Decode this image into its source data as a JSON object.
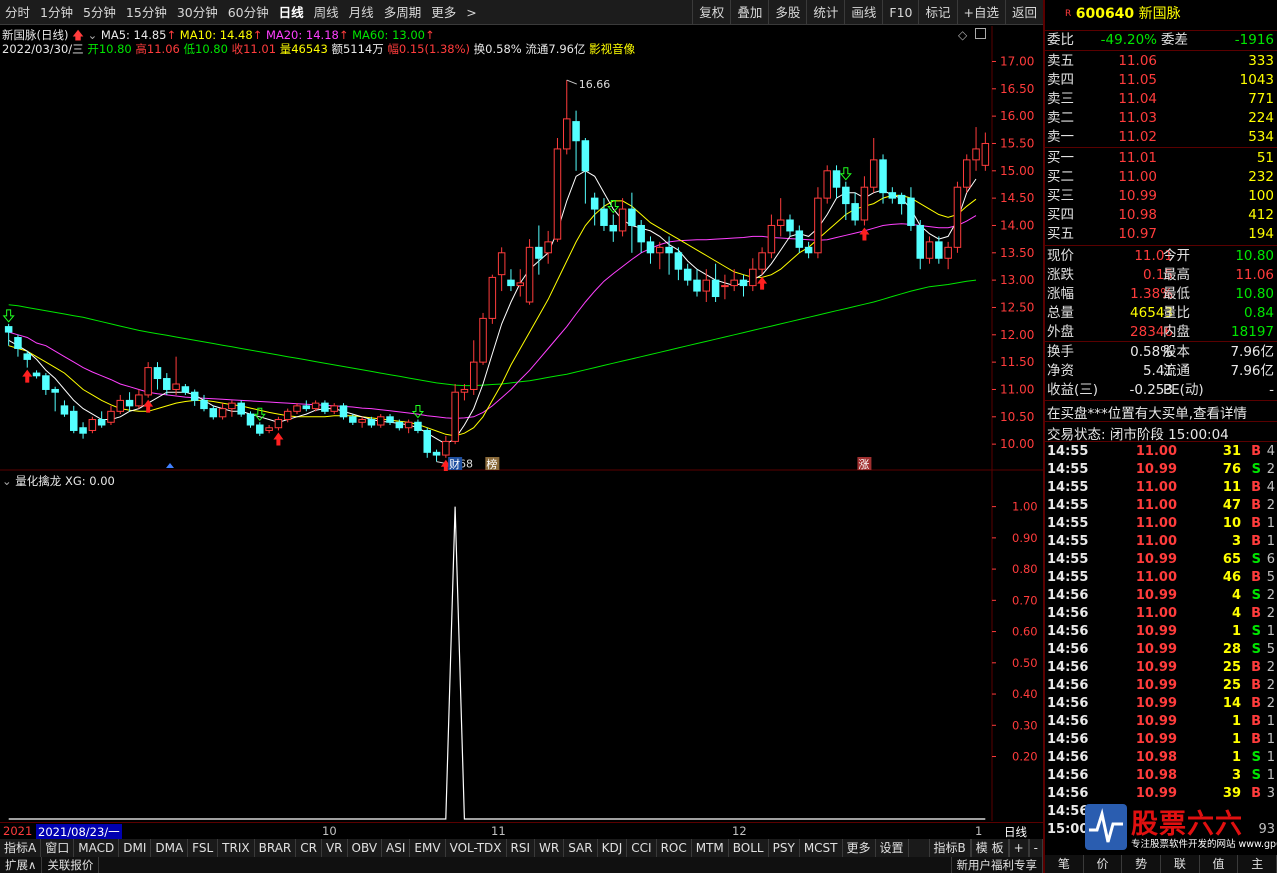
{
  "toolbar": {
    "timeframes": [
      "分时",
      "1分钟",
      "5分钟",
      "15分钟",
      "30分钟",
      "60分钟",
      "日线",
      "周线",
      "月线",
      "多周期",
      "更多"
    ],
    "active_timeframe": "日线",
    "more_arrow": ">",
    "right_buttons": [
      "复权",
      "叠加",
      "多股",
      "统计",
      "画线",
      "F10",
      "标记",
      "+自选",
      "返回"
    ]
  },
  "chart_header": {
    "name": "新国脉(日线)",
    "ma5": "MA5: 14.85",
    "ma10": "MA10: 14.48",
    "ma20": "MA20: 14.18",
    "ma60": "MA60: 13.00",
    "date": "2022/03/30/三",
    "open": "开10.80",
    "high": "高11.06",
    "low": "低10.80",
    "close": "收11.01",
    "volume": "量46543",
    "amount": "额5114万",
    "range": "幅0.15(1.38%)",
    "turnover": "换0.58%",
    "float": "流通7.96亿",
    "concept": "影视音像",
    "high_label": "16.66",
    "low_label": "9.68",
    "marker_cai": "财",
    "marker_bang": "榜",
    "marker_zhang": "涨"
  },
  "indicator_header": {
    "name": "量化擒龙",
    "value": "XG: 0.00"
  },
  "price_axis": [
    "17.00",
    "16.50",
    "16.00",
    "15.50",
    "15.00",
    "14.50",
    "14.00",
    "13.50",
    "13.00",
    "12.50",
    "12.00",
    "11.50",
    "11.00",
    "10.50",
    "10.00"
  ],
  "ind_axis": [
    "1.00",
    "0.90",
    "0.80",
    "0.70",
    "0.60",
    "0.50",
    "0.40",
    "0.30",
    "0.20"
  ],
  "datebar": {
    "start": "2021",
    "cursor": "2021/08/23/一",
    "m10": "10",
    "m11": "11",
    "m12": "12",
    "m1": "1",
    "period": "日线"
  },
  "indicator_tabs": [
    "指标A",
    "窗口",
    "MACD",
    "DMI",
    "DMA",
    "FSL",
    "TRIX",
    "BRAR",
    "CR",
    "VR",
    "OBV",
    "ASI",
    "EMV",
    "VOL-TDX",
    "RSI",
    "WR",
    "SAR",
    "KDJ",
    "CCI",
    "ROC",
    "MTM",
    "BOLL",
    "PSY",
    "MCST",
    "更多",
    "设置"
  ],
  "indicator_tabs_right": [
    "指标B",
    "模 板",
    "+",
    "-"
  ],
  "statusbar": [
    "扩展∧",
    "关联报价"
  ],
  "statusbar_right": "新用户福利专享",
  "stock": {
    "badge": "R",
    "code": "600640",
    "name": "新国脉"
  },
  "order_ratio": {
    "l1": "委比",
    "v1": "-49.20%",
    "l2": "委差",
    "v2": "-1916"
  },
  "asks": [
    {
      "label": "卖五",
      "price": "11.06",
      "vol": "333"
    },
    {
      "label": "卖四",
      "price": "11.05",
      "vol": "1043"
    },
    {
      "label": "卖三",
      "price": "11.04",
      "vol": "771"
    },
    {
      "label": "卖二",
      "price": "11.03",
      "vol": "224"
    },
    {
      "label": "卖一",
      "price": "11.02",
      "vol": "534"
    }
  ],
  "bids": [
    {
      "label": "买一",
      "price": "11.01",
      "vol": "51"
    },
    {
      "label": "买二",
      "price": "11.00",
      "vol": "232"
    },
    {
      "label": "买三",
      "price": "10.99",
      "vol": "100"
    },
    {
      "label": "买四",
      "price": "10.98",
      "vol": "412"
    },
    {
      "label": "买五",
      "price": "10.97",
      "vol": "194"
    }
  ],
  "quote": [
    {
      "l1": "现价",
      "v1": "11.01",
      "c1": "red",
      "l2": "今开",
      "v2": "10.80",
      "c2": "green"
    },
    {
      "l1": "涨跌",
      "v1": "0.15",
      "c1": "red",
      "l2": "最高",
      "v2": "11.06",
      "c2": "red"
    },
    {
      "l1": "涨幅",
      "v1": "1.38%",
      "c1": "red",
      "l2": "最低",
      "v2": "10.80",
      "c2": "green"
    },
    {
      "l1": "总量",
      "v1": "46543",
      "c1": "yellow",
      "l2": "量比",
      "v2": "0.84",
      "c2": "green"
    },
    {
      "l1": "外盘",
      "v1": "28346",
      "c1": "red",
      "l2": "内盘",
      "v2": "18197",
      "c2": "green"
    }
  ],
  "quote2": [
    {
      "l1": "换手",
      "v1": "0.58%",
      "l2": "股本",
      "v2": "7.96亿"
    },
    {
      "l1": "净资",
      "v1": "5.41",
      "l2": "流通",
      "v2": "7.96亿"
    },
    {
      "l1": "收益(三)",
      "v1": "-0.253",
      "l2": "PE(动)",
      "v2": "-"
    }
  ],
  "notice": "在买盘***位置有大买单,查看详情",
  "trade_status": "交易状态: 闭市阶段 15:00:04",
  "ticks": [
    {
      "t": "14:55",
      "p": "11.00",
      "v": "31",
      "d": "B",
      "n": "4"
    },
    {
      "t": "14:55",
      "p": "10.99",
      "v": "76",
      "d": "S",
      "n": "2"
    },
    {
      "t": "14:55",
      "p": "11.00",
      "v": "11",
      "d": "B",
      "n": "4"
    },
    {
      "t": "14:55",
      "p": "11.00",
      "v": "47",
      "d": "B",
      "n": "2"
    },
    {
      "t": "14:55",
      "p": "11.00",
      "v": "10",
      "d": "B",
      "n": "1"
    },
    {
      "t": "14:55",
      "p": "11.00",
      "v": "3",
      "d": "B",
      "n": "1"
    },
    {
      "t": "14:55",
      "p": "10.99",
      "v": "65",
      "d": "S",
      "n": "6"
    },
    {
      "t": "14:55",
      "p": "11.00",
      "v": "46",
      "d": "B",
      "n": "5"
    },
    {
      "t": "14:56",
      "p": "10.99",
      "v": "4",
      "d": "S",
      "n": "2"
    },
    {
      "t": "14:56",
      "p": "11.00",
      "v": "4",
      "d": "B",
      "n": "2"
    },
    {
      "t": "14:56",
      "p": "10.99",
      "v": "1",
      "d": "S",
      "n": "1"
    },
    {
      "t": "14:56",
      "p": "10.99",
      "v": "28",
      "d": "S",
      "n": "5"
    },
    {
      "t": "14:56",
      "p": "10.99",
      "v": "25",
      "d": "B",
      "n": "2"
    },
    {
      "t": "14:56",
      "p": "10.99",
      "v": "25",
      "d": "B",
      "n": "2"
    },
    {
      "t": "14:56",
      "p": "10.99",
      "v": "14",
      "d": "B",
      "n": "2"
    },
    {
      "t": "14:56",
      "p": "10.99",
      "v": "1",
      "d": "B",
      "n": "1"
    },
    {
      "t": "14:56",
      "p": "10.99",
      "v": "1",
      "d": "B",
      "n": "1"
    },
    {
      "t": "14:56",
      "p": "10.98",
      "v": "1",
      "d": "S",
      "n": "1"
    },
    {
      "t": "14:56",
      "p": "10.98",
      "v": "3",
      "d": "S",
      "n": "1"
    },
    {
      "t": "14:56",
      "p": "10.99",
      "v": "39",
      "d": "B",
      "n": "3"
    },
    {
      "t": "14:56",
      "p": "",
      "v": "",
      "d": "",
      "n": ""
    },
    {
      "t": "15:00",
      "p": "",
      "v": "",
      "d": "",
      "n": "93"
    }
  ],
  "right_tabs": [
    "笔",
    "价",
    "势",
    "联",
    "值",
    "主"
  ],
  "watermark": {
    "title": "股票六六",
    "url": "专注股票软件开发的网站 www.gp66.cn"
  },
  "chart_data": {
    "type": "candlestick",
    "price_range": [
      9.6,
      17.1
    ],
    "candles": [
      [
        12.15,
        12.05,
        11.8,
        12.2
      ],
      [
        11.95,
        11.75,
        11.6,
        12.0
      ],
      [
        11.65,
        11.55,
        11.4,
        11.7
      ],
      [
        11.3,
        11.25,
        11.2,
        11.35
      ],
      [
        11.25,
        11.0,
        10.9,
        11.3
      ],
      [
        11.0,
        10.95,
        10.6,
        11.05
      ],
      [
        10.7,
        10.55,
        10.5,
        10.8
      ],
      [
        10.6,
        10.25,
        10.2,
        10.7
      ],
      [
        10.3,
        10.2,
        10.1,
        10.4
      ],
      [
        10.25,
        10.45,
        10.2,
        10.5
      ],
      [
        10.45,
        10.35,
        10.3,
        10.6
      ],
      [
        10.4,
        10.6,
        10.35,
        10.7
      ],
      [
        10.6,
        10.8,
        10.55,
        10.9
      ],
      [
        10.8,
        10.7,
        10.6,
        10.95
      ],
      [
        10.7,
        10.9,
        10.65,
        11.0
      ],
      [
        10.9,
        11.4,
        10.85,
        11.5
      ],
      [
        11.4,
        11.2,
        11.0,
        11.5
      ],
      [
        11.2,
        11.0,
        10.9,
        11.3
      ],
      [
        11.0,
        11.1,
        10.9,
        11.6
      ],
      [
        11.05,
        10.95,
        10.9,
        11.1
      ],
      [
        10.95,
        10.8,
        10.7,
        11.0
      ],
      [
        10.8,
        10.65,
        10.6,
        10.9
      ],
      [
        10.65,
        10.5,
        10.45,
        10.7
      ],
      [
        10.5,
        10.65,
        10.45,
        10.75
      ],
      [
        10.65,
        10.75,
        10.5,
        10.8
      ],
      [
        10.75,
        10.55,
        10.5,
        10.8
      ],
      [
        10.55,
        10.35,
        10.3,
        10.6
      ],
      [
        10.35,
        10.2,
        10.15,
        10.4
      ],
      [
        10.25,
        10.3,
        10.2,
        10.35
      ],
      [
        10.3,
        10.45,
        10.25,
        10.5
      ],
      [
        10.45,
        10.6,
        10.4,
        10.65
      ],
      [
        10.6,
        10.7,
        10.55,
        10.75
      ],
      [
        10.7,
        10.65,
        10.6,
        10.8
      ],
      [
        10.65,
        10.75,
        10.6,
        10.8
      ],
      [
        10.75,
        10.6,
        10.55,
        10.8
      ],
      [
        10.6,
        10.7,
        10.55,
        10.75
      ],
      [
        10.7,
        10.5,
        10.45,
        10.75
      ],
      [
        10.5,
        10.4,
        10.35,
        10.55
      ],
      [
        10.4,
        10.45,
        10.3,
        10.5
      ],
      [
        10.45,
        10.35,
        10.3,
        10.5
      ],
      [
        10.35,
        10.5,
        10.3,
        10.55
      ],
      [
        10.5,
        10.4,
        10.35,
        10.55
      ],
      [
        10.4,
        10.3,
        10.25,
        10.45
      ],
      [
        10.3,
        10.4,
        10.2,
        10.45
      ],
      [
        10.4,
        10.25,
        10.2,
        10.45
      ],
      [
        10.25,
        9.85,
        9.75,
        10.3
      ],
      [
        9.85,
        9.8,
        9.68,
        9.9
      ],
      [
        9.8,
        10.05,
        9.75,
        10.15
      ],
      [
        10.05,
        10.95,
        10.0,
        11.1
      ],
      [
        10.95,
        11.0,
        10.8,
        11.1
      ],
      [
        11.0,
        11.5,
        10.9,
        11.9
      ],
      [
        11.5,
        12.3,
        11.45,
        12.4
      ],
      [
        12.3,
        13.05,
        12.2,
        13.1
      ],
      [
        13.1,
        13.5,
        12.8,
        13.6
      ],
      [
        13.0,
        12.9,
        12.8,
        13.2
      ],
      [
        12.9,
        12.95,
        12.7,
        13.2
      ],
      [
        12.6,
        13.6,
        12.55,
        13.75
      ],
      [
        13.6,
        13.4,
        13.1,
        14.0
      ],
      [
        13.5,
        13.7,
        13.3,
        13.9
      ],
      [
        13.75,
        15.4,
        13.7,
        15.6
      ],
      [
        15.4,
        15.95,
        15.3,
        16.66
      ],
      [
        15.9,
        15.55,
        15.0,
        16.1
      ],
      [
        15.55,
        15.0,
        14.4,
        15.6
      ],
      [
        14.5,
        14.3,
        14.0,
        14.6
      ],
      [
        14.3,
        14.0,
        13.9,
        14.5
      ],
      [
        14.0,
        13.9,
        13.7,
        14.2
      ],
      [
        13.9,
        14.3,
        13.8,
        14.5
      ],
      [
        14.3,
        14.0,
        13.5,
        14.6
      ],
      [
        14.0,
        13.7,
        13.5,
        14.1
      ],
      [
        13.7,
        13.5,
        13.3,
        13.8
      ],
      [
        13.5,
        13.6,
        13.2,
        13.7
      ],
      [
        13.6,
        13.5,
        13.1,
        13.8
      ],
      [
        13.5,
        13.2,
        13.0,
        13.6
      ],
      [
        13.2,
        13.0,
        12.9,
        13.3
      ],
      [
        13.0,
        12.8,
        12.7,
        13.2
      ],
      [
        12.8,
        13.0,
        12.6,
        13.2
      ],
      [
        13.0,
        12.7,
        12.6,
        13.3
      ],
      [
        12.9,
        12.9,
        12.65,
        13.1
      ],
      [
        12.9,
        13.0,
        12.8,
        13.2
      ],
      [
        13.0,
        12.9,
        12.7,
        13.1
      ],
      [
        12.9,
        13.2,
        12.8,
        13.4
      ],
      [
        13.2,
        13.5,
        13.1,
        13.6
      ],
      [
        13.5,
        14.0,
        13.4,
        14.2
      ],
      [
        14.0,
        14.1,
        13.8,
        14.5
      ],
      [
        14.1,
        13.9,
        13.8,
        14.2
      ],
      [
        13.9,
        13.6,
        13.5,
        14.0
      ],
      [
        13.6,
        13.5,
        13.4,
        13.7
      ],
      [
        13.5,
        14.5,
        13.4,
        14.7
      ],
      [
        14.5,
        15.0,
        14.4,
        15.1
      ],
      [
        15.0,
        14.7,
        14.5,
        15.1
      ],
      [
        14.7,
        14.4,
        14.1,
        14.8
      ],
      [
        14.4,
        14.1,
        14.0,
        14.6
      ],
      [
        14.1,
        14.7,
        14.0,
        14.9
      ],
      [
        14.7,
        15.2,
        14.6,
        15.6
      ],
      [
        15.2,
        14.6,
        14.4,
        15.3
      ],
      [
        14.6,
        14.5,
        14.4,
        14.7
      ],
      [
        14.55,
        14.4,
        14.2,
        14.6
      ],
      [
        14.5,
        14.0,
        13.9,
        14.7
      ],
      [
        14.0,
        13.4,
        13.2,
        14.1
      ],
      [
        13.4,
        13.7,
        13.3,
        13.8
      ],
      [
        13.7,
        13.4,
        13.3,
        13.8
      ],
      [
        13.4,
        13.6,
        13.2,
        13.7
      ],
      [
        13.6,
        14.7,
        13.5,
        14.8
      ],
      [
        14.7,
        15.2,
        14.6,
        15.3
      ],
      [
        15.2,
        15.4,
        15.0,
        15.8
      ],
      [
        15.1,
        15.5,
        15.0,
        15.7
      ]
    ],
    "ma5": [
      11.9,
      11.8,
      11.7,
      11.55,
      11.35,
      11.2,
      11.0,
      10.8,
      10.65,
      10.55,
      10.45,
      10.45,
      10.5,
      10.6,
      10.65,
      10.75,
      10.85,
      10.95,
      10.95,
      10.95,
      10.9,
      10.8,
      10.7,
      10.65,
      10.6,
      10.6,
      10.55,
      10.5,
      10.45,
      10.4,
      10.45,
      10.5,
      10.55,
      10.62,
      10.65,
      10.65,
      10.6,
      10.55,
      10.5,
      10.45,
      10.42,
      10.4,
      10.38,
      10.35,
      10.3,
      10.2,
      10.1,
      10.0,
      10.1,
      10.35,
      10.65,
      11.1,
      11.65,
      12.2,
      12.6,
      12.95,
      13.2,
      13.35,
      13.5,
      13.9,
      14.45,
      14.9,
      15.0,
      14.9,
      14.6,
      14.3,
      14.1,
      14.0,
      13.95,
      13.9,
      13.8,
      13.65,
      13.55,
      13.35,
      13.2,
      13.1,
      13.0,
      12.95,
      12.9,
      12.95,
      13.0,
      13.1,
      13.3,
      13.55,
      13.8,
      13.85,
      13.8,
      13.95,
      14.2,
      14.5,
      14.6,
      14.6,
      14.5,
      14.6,
      14.65,
      14.55,
      14.5,
      14.3,
      14.0,
      13.85,
      13.75,
      13.8,
      14.1,
      14.6,
      14.85
    ],
    "ma10": [
      11.8,
      11.75,
      11.7,
      11.6,
      11.5,
      11.4,
      11.3,
      11.15,
      11.0,
      10.9,
      10.8,
      10.72,
      10.65,
      10.62,
      10.6,
      10.6,
      10.65,
      10.7,
      10.75,
      10.78,
      10.8,
      10.8,
      10.78,
      10.75,
      10.72,
      10.7,
      10.66,
      10.62,
      10.58,
      10.55,
      10.52,
      10.5,
      10.5,
      10.5,
      10.5,
      10.52,
      10.52,
      10.52,
      10.5,
      10.48,
      10.46,
      10.44,
      10.42,
      10.4,
      10.36,
      10.3,
      10.24,
      10.18,
      10.15,
      10.2,
      10.3,
      10.5,
      10.8,
      11.1,
      11.45,
      11.75,
      12.05,
      12.35,
      12.65,
      13.0,
      13.35,
      13.7,
      14.0,
      14.2,
      14.35,
      14.45,
      14.45,
      14.35,
      14.2,
      14.05,
      13.95,
      13.85,
      13.75,
      13.65,
      13.55,
      13.45,
      13.35,
      13.25,
      13.15,
      13.1,
      13.05,
      13.05,
      13.1,
      13.2,
      13.35,
      13.5,
      13.6,
      13.75,
      13.9,
      14.05,
      14.2,
      14.3,
      14.35,
      14.4,
      14.5,
      14.55,
      14.55,
      14.5,
      14.4,
      14.3,
      14.2,
      14.15,
      14.2,
      14.35,
      14.48
    ],
    "ma20": [
      12.05,
      12.0,
      11.95,
      11.85,
      11.8,
      11.7,
      11.6,
      11.5,
      11.4,
      11.32,
      11.25,
      11.18,
      11.1,
      11.05,
      11.0,
      10.95,
      10.92,
      10.9,
      10.88,
      10.86,
      10.85,
      10.84,
      10.83,
      10.82,
      10.81,
      10.8,
      10.79,
      10.78,
      10.77,
      10.76,
      10.75,
      10.74,
      10.73,
      10.72,
      10.71,
      10.7,
      10.69,
      10.68,
      10.66,
      10.65,
      10.63,
      10.61,
      10.59,
      10.57,
      10.55,
      10.52,
      10.5,
      10.48,
      10.47,
      10.48,
      10.5,
      10.58,
      10.7,
      10.85,
      11.0,
      11.18,
      11.35,
      11.55,
      11.75,
      11.95,
      12.15,
      12.38,
      12.6,
      12.8,
      12.98,
      13.12,
      13.25,
      13.38,
      13.5,
      13.58,
      13.65,
      13.7,
      13.72,
      13.73,
      13.74,
      13.74,
      13.75,
      13.76,
      13.77,
      13.78,
      13.8,
      13.8,
      13.78,
      13.77,
      13.76,
      13.75,
      13.74,
      13.73,
      13.74,
      13.78,
      13.82,
      13.86,
      13.9,
      13.95,
      14.0,
      14.02,
      14.03,
      14.02,
      14.0,
      13.98,
      13.96,
      13.96,
      14.0,
      14.08,
      14.18
    ],
    "ma60": [
      12.55,
      12.53,
      12.5,
      12.47,
      12.44,
      12.41,
      12.38,
      12.35,
      12.32,
      12.28,
      12.24,
      12.2,
      12.16,
      12.12,
      12.08,
      12.05,
      12.02,
      11.99,
      11.96,
      11.93,
      11.9,
      11.87,
      11.84,
      11.81,
      11.78,
      11.75,
      11.72,
      11.69,
      11.66,
      11.63,
      11.6,
      11.57,
      11.54,
      11.51,
      11.48,
      11.45,
      11.42,
      11.39,
      11.36,
      11.33,
      11.3,
      11.27,
      11.24,
      11.21,
      11.18,
      11.15,
      11.12,
      11.1,
      11.08,
      11.07,
      11.07,
      11.08,
      11.09,
      11.1,
      11.12,
      11.14,
      11.16,
      11.19,
      11.22,
      11.25,
      11.28,
      11.32,
      11.36,
      11.4,
      11.44,
      11.48,
      11.52,
      11.56,
      11.6,
      11.64,
      11.68,
      11.72,
      11.76,
      11.8,
      11.84,
      11.88,
      11.92,
      11.96,
      12.0,
      12.04,
      12.08,
      12.12,
      12.16,
      12.2,
      12.24,
      12.28,
      12.32,
      12.36,
      12.4,
      12.44,
      12.48,
      12.52,
      12.56,
      12.6,
      12.65,
      12.7,
      12.75,
      12.8,
      12.84,
      12.88,
      12.9,
      12.92,
      12.95,
      12.98,
      13.0
    ],
    "xg": {
      "spike_index": 48,
      "value": 1.0,
      "ylim": [
        0,
        1.05
      ]
    }
  },
  "colors": {
    "up": "#ff3c3c",
    "down": "#54ffff",
    "ma5": "#ffffff",
    "ma10": "#ffff00",
    "ma20": "#ff40ff",
    "ma60": "#00e600",
    "grid": "#5a0000"
  }
}
